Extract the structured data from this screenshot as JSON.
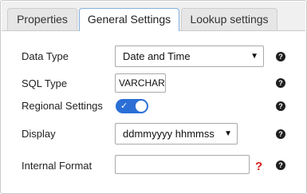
{
  "tabs": [
    {
      "label": "Properties"
    },
    {
      "label": "General Settings"
    },
    {
      "label": "Lookup settings"
    }
  ],
  "fields": {
    "data_type": {
      "label": "Data Type",
      "value": "Date and Time"
    },
    "sql_type": {
      "label": "SQL Type",
      "value": "VARCHAR"
    },
    "regional_settings": {
      "label": "Regional Settings",
      "enabled": true
    },
    "display": {
      "label": "Display",
      "value": "ddmmyyyy hhmmss"
    },
    "internal_format": {
      "label": "Internal Format",
      "value": "",
      "missing_indicator": "?"
    }
  },
  "help_glyph": "?",
  "colors": {
    "accent": "#2b6fd6",
    "active_tab_border": "#7fb0e0",
    "warning": "#d81b1b"
  }
}
